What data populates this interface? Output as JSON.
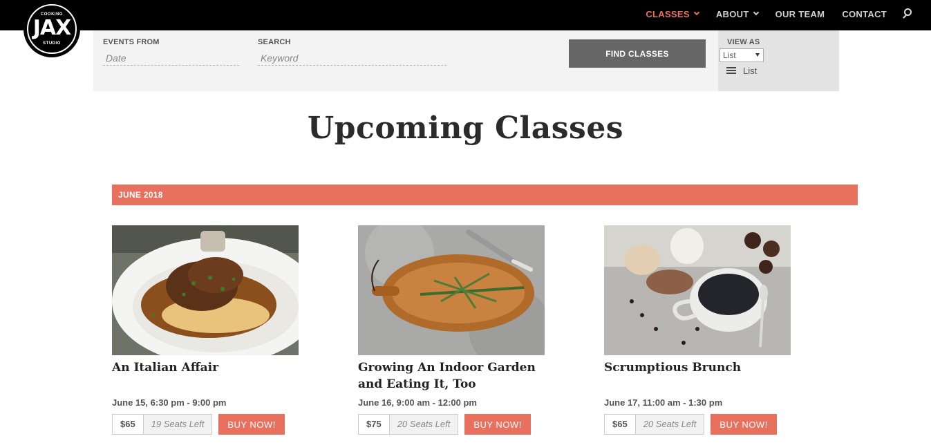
{
  "brand": {
    "top": "COOKING",
    "main": "JAX",
    "bottom": "STUDIO"
  },
  "nav": {
    "items": [
      {
        "label": "CLASSES",
        "dropdown": true,
        "active": true
      },
      {
        "label": "ABOUT",
        "dropdown": true,
        "active": false
      },
      {
        "label": "OUR TEAM",
        "dropdown": false,
        "active": false
      },
      {
        "label": "CONTACT",
        "dropdown": false,
        "active": false
      }
    ],
    "search_icon": "search-icon"
  },
  "filter": {
    "events_from_label": "EVENTS FROM",
    "date_placeholder": "Date",
    "search_label": "SEARCH",
    "keyword_placeholder": "Keyword",
    "find_button": "FIND CLASSES",
    "view_as_label": "VIEW AS",
    "view_select_value": "List",
    "view_list_label": "List"
  },
  "heading": "Upcoming Classes",
  "month": "JUNE 2018",
  "colors": {
    "accent": "#e8705f",
    "nav_bg": "#000000",
    "button_gray": "#666666"
  },
  "classes": [
    {
      "title": "An Italian Affair",
      "date": "June 15, 6:30 pm - 9:00 pm",
      "price": "$65",
      "seats": "19 Seats Left",
      "buy": "BUY NOW!"
    },
    {
      "title": "Growing An Indoor Garden and Eating It, Too",
      "date": "June 16, 9:00 am - 12:00 pm",
      "price": "$75",
      "seats": "20 Seats Left",
      "buy": "BUY NOW!"
    },
    {
      "title": "Scrumptious Brunch",
      "date": "June 17, 11:00 am - 1:30 pm",
      "price": "$65",
      "seats": "20 Seats Left",
      "buy": "BUY NOW!"
    }
  ]
}
